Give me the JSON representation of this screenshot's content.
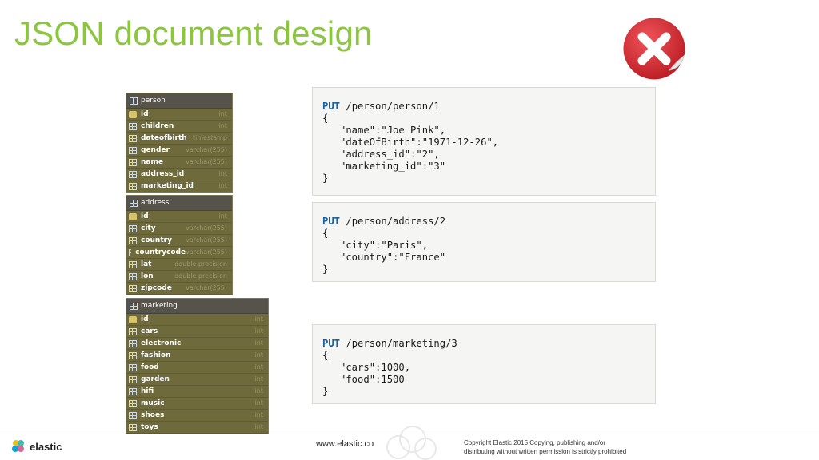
{
  "slide": {
    "title": "JSON document design",
    "reject_icon": "red-x-sticker-icon"
  },
  "tables": [
    {
      "name": "person",
      "columns": [
        {
          "name": "id",
          "type": "int",
          "key": true
        },
        {
          "name": "children",
          "type": "int",
          "key": false
        },
        {
          "name": "dateofbirth",
          "type": "timestamp",
          "key": false
        },
        {
          "name": "gender",
          "type": "varchar(255)",
          "key": false
        },
        {
          "name": "name",
          "type": "varchar(255)",
          "key": false
        },
        {
          "name": "address_id",
          "type": "int",
          "key": false
        },
        {
          "name": "marketing_id",
          "type": "int",
          "key": false
        }
      ]
    },
    {
      "name": "address",
      "columns": [
        {
          "name": "id",
          "type": "int",
          "key": true
        },
        {
          "name": "city",
          "type": "varchar(255)",
          "key": false
        },
        {
          "name": "country",
          "type": "varchar(255)",
          "key": false
        },
        {
          "name": "countrycode",
          "type": "varchar(255)",
          "key": false
        },
        {
          "name": "lat",
          "type": "double precision",
          "key": false
        },
        {
          "name": "lon",
          "type": "double precision",
          "key": false
        },
        {
          "name": "zipcode",
          "type": "varchar(255)",
          "key": false
        }
      ]
    },
    {
      "name": "marketing",
      "columns": [
        {
          "name": "id",
          "type": "int",
          "key": true
        },
        {
          "name": "cars",
          "type": "int",
          "key": false
        },
        {
          "name": "electronic",
          "type": "int",
          "key": false
        },
        {
          "name": "fashion",
          "type": "int",
          "key": false
        },
        {
          "name": "food",
          "type": "int",
          "key": false
        },
        {
          "name": "garden",
          "type": "int",
          "key": false
        },
        {
          "name": "hifi",
          "type": "int",
          "key": false
        },
        {
          "name": "music",
          "type": "int",
          "key": false
        },
        {
          "name": "shoes",
          "type": "int",
          "key": false
        },
        {
          "name": "toys",
          "type": "int",
          "key": false
        }
      ]
    }
  ],
  "code_blocks": [
    {
      "method": "PUT",
      "path": " /person/person/1",
      "body": [
        "{",
        "   \"name\":\"Joe Pink\",",
        "   \"dateOfBirth\":\"1971-12-26\",",
        "   \"address_id\":\"2\",",
        "   \"marketing_id\":\"3\"",
        "}"
      ]
    },
    {
      "method": "PUT",
      "path": " /person/address/2",
      "body": [
        "{",
        "   \"city\":\"Paris\",",
        "   \"country\":\"France\"",
        "}"
      ]
    },
    {
      "method": "PUT",
      "path": " /person/marketing/3",
      "body": [
        "{",
        "   \"cars\":1000,",
        "   \"food\":1500",
        "}"
      ]
    }
  ],
  "footer": {
    "logo_text": "elastic",
    "url": "www.elastic.co",
    "copyright_line1": "Copyright Elastic 2015 Copying, publishing and/or",
    "copyright_line2": "distributing without written permission is strictly prohibited"
  },
  "colors": {
    "title_green": "#8cc63f",
    "reject_red": "#d9262c",
    "method_blue": "#1a5fa0"
  }
}
